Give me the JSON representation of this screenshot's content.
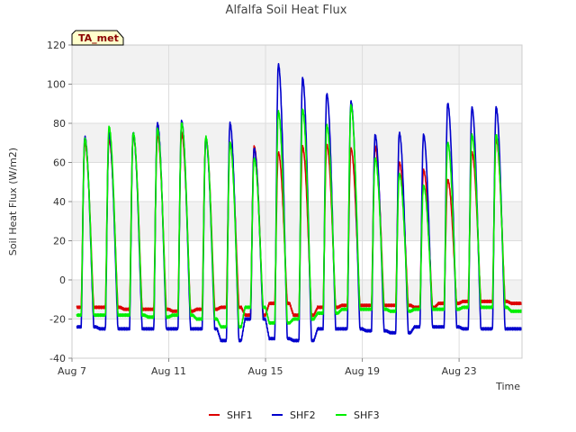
{
  "chart_data": {
    "type": "line",
    "title": "Alfalfa Soil Heat Flux",
    "xlabel": "Time",
    "ylabel": "Soil Heat Flux (W/m2)",
    "ylim": [
      -40,
      120
    ],
    "yticks": [
      -40,
      -20,
      0,
      20,
      40,
      60,
      80,
      100,
      120
    ],
    "xlim": [
      7.0,
      25.6
    ],
    "xticks": [
      {
        "label": "Aug 7",
        "value": 7
      },
      {
        "label": "Aug 11",
        "value": 11
      },
      {
        "label": "Aug 15",
        "value": 15
      },
      {
        "label": "Aug 19",
        "value": 19
      },
      {
        "label": "Aug 23",
        "value": 23
      }
    ],
    "grid": true,
    "legend_position": "bottom-center",
    "annotation": "TA_met",
    "day_start": 7,
    "series": [
      {
        "name": "SHF1",
        "color": "#dd0000",
        "night": [
          -14,
          -14,
          -15,
          -15,
          -16,
          -15,
          -14,
          -18,
          -12,
          -18,
          -14,
          -13,
          -13,
          -13,
          -14,
          -12,
          -11,
          -11,
          -12
        ],
        "peak": [
          70,
          72,
          74,
          74,
          75,
          72,
          70,
          68,
          65,
          68,
          69,
          67,
          68,
          60,
          56,
          51,
          65,
          72,
          -12
        ]
      },
      {
        "name": "SHF2",
        "color": "#0000cc",
        "night": [
          -24,
          -25,
          -25,
          -25,
          -25,
          -25,
          -31,
          -20,
          -30,
          -31,
          -25,
          -25,
          -26,
          -27,
          -24,
          -24,
          -25,
          -25,
          -25
        ],
        "peak": [
          73,
          75,
          75,
          80,
          81,
          72,
          80,
          67,
          110,
          103,
          95,
          91,
          74,
          75,
          74,
          90,
          88,
          88,
          -25
        ]
      },
      {
        "name": "SHF3",
        "color": "#00ee00",
        "night": [
          -18,
          -18,
          -18,
          -19,
          -18,
          -20,
          -24,
          -14,
          -22,
          -20,
          -17,
          -15,
          -15,
          -16,
          -15,
          -15,
          -14,
          -14,
          -16
        ],
        "peak": [
          72,
          78,
          75,
          77,
          80,
          73,
          70,
          62,
          86,
          87,
          79,
          89,
          62,
          54,
          48,
          70,
          74,
          74,
          -16
        ]
      }
    ]
  }
}
